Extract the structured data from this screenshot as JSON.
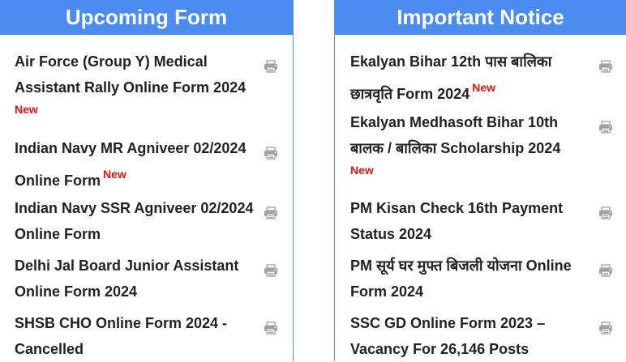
{
  "left_panel": {
    "title": "Upcoming Form",
    "items": [
      {
        "text": "Air Force (Group Y) Medical Assistant Rally Online Form 2024",
        "badge": "New"
      },
      {
        "text": "Indian Navy MR Agniveer 02/2024 Online Form",
        "badge": "New"
      },
      {
        "text": "Indian Navy SSR Agniveer 02/2024 Online Form"
      },
      {
        "text": "Delhi Jal Board Junior Assistant Online Form 2024"
      },
      {
        "text": "SHSB CHO Online Form 2024 - Cancelled"
      }
    ]
  },
  "right_panel": {
    "title": "Important Notice",
    "items": [
      {
        "text": "Ekalyan Bihar 12th पास बालिका छात्रवृति Form 2024",
        "badge": "New"
      },
      {
        "text": "Ekalyan Medhasoft Bihar 10th बालक / बालिका Scholarship 2024",
        "badge": "New"
      },
      {
        "text": "PM Kisan Check 16th Payment Status 2024"
      },
      {
        "text": "PM सूर्य घर मुफ्त बिजली योजना Online Form 2024"
      },
      {
        "text": "SSC GD Online Form 2023 – Vacancy For 26,146 Posts"
      }
    ]
  },
  "icons": {
    "print": "printer-icon"
  },
  "colors": {
    "header_bg": "#4a8cf0",
    "badge": "#ee1111",
    "text": "#222222"
  }
}
